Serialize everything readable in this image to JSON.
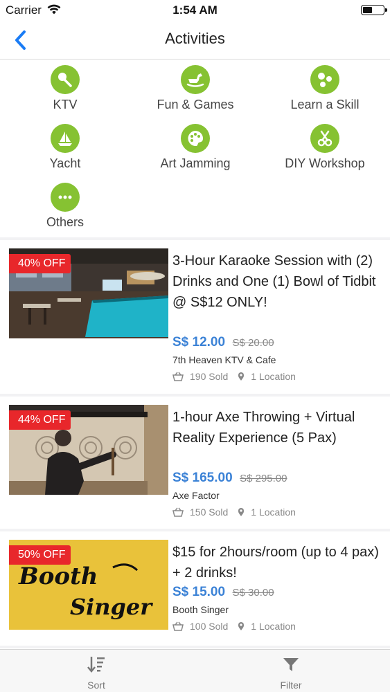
{
  "status_bar": {
    "carrier": "Carrier",
    "time": "1:54 AM",
    "battery_level": 0.45
  },
  "nav": {
    "title": "Activities",
    "back_icon": "chevron-left-icon"
  },
  "categories": [
    {
      "label": "KTV",
      "icon": "microphone-icon"
    },
    {
      "label": "Fun & Games",
      "icon": "rocking-horse-icon"
    },
    {
      "label": "Learn a Skill",
      "icon": "molecule-icon"
    },
    {
      "label": "Yacht",
      "icon": "sailboat-icon"
    },
    {
      "label": "Art Jamming",
      "icon": "palette-icon"
    },
    {
      "label": "DIY Workshop",
      "icon": "scissors-icon"
    },
    {
      "label": "Others",
      "icon": "more-dots-icon"
    }
  ],
  "deals": [
    {
      "badge": "40% OFF",
      "title": "3-Hour Karaoke Session with (2) Drinks and One (1) Bowl of Tidbit @ S$12 ONLY!",
      "price": "S$ 12.00",
      "original_price": "S$ 20.00",
      "merchant": "7th Heaven KTV & Cafe",
      "sold": "190 Sold",
      "locations": "1 Location"
    },
    {
      "badge": "44% OFF",
      "title": "1-hour Axe Throwing + Virtual Reality Experience (5 Pax)",
      "price": "S$ 165.00",
      "original_price": "S$ 295.00",
      "merchant": "Axe Factor",
      "sold": "150 Sold",
      "locations": "1 Location"
    },
    {
      "badge": "50% OFF",
      "title": "$15 for 2hours/room (up to 4 pax) + 2 drinks!",
      "price": "S$ 15.00",
      "original_price": "S$ 30.00",
      "merchant": "Booth Singer",
      "sold": "100 Sold",
      "locations": "1 Location",
      "image_text": [
        "Booth",
        "Singer"
      ]
    }
  ],
  "tab_bar": {
    "sort": {
      "label": "Sort",
      "icon": "sort-icon"
    },
    "filter": {
      "label": "Filter",
      "icon": "filter-icon"
    }
  },
  "colors": {
    "accent_green": "#86c232",
    "price_blue": "#3b82d6",
    "badge_red": "#e8272b",
    "ios_blue": "#1a7cf5"
  }
}
